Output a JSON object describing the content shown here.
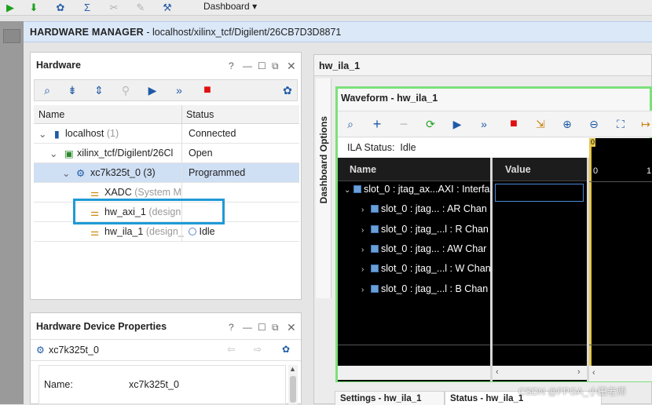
{
  "toolbar": {
    "dashboard_label": "Dashboard"
  },
  "header": {
    "title_bold": "HARDWARE MANAGER",
    "title_path": " - localhost/xilinx_tcf/Digilent/26CB7D3D8871"
  },
  "hardware": {
    "title": "Hardware",
    "columns": [
      "Name",
      "Status"
    ],
    "rows": [
      {
        "name": "localhost",
        "extra": "(1)",
        "status": "Connected"
      },
      {
        "name": "xilinx_tcf/Digilent/26Cl",
        "extra": "",
        "status": "Open"
      },
      {
        "name": "xc7k325t_0",
        "extra": "(3)",
        "status": "Programmed"
      },
      {
        "name": "XADC",
        "extra": "(System M",
        "status": ""
      },
      {
        "name": "hw_axi_1",
        "extra": "(design",
        "status": ""
      },
      {
        "name": "hw_ila_1",
        "extra": "(design_",
        "status": "Idle"
      }
    ]
  },
  "properties": {
    "title": "Hardware Device Properties",
    "device": "xc7k325t_0",
    "name_label": "Name:",
    "name_value": "xc7k325t_0"
  },
  "right": {
    "tab_title": "hw_ila_1",
    "dashboard_options": "Dashboard Options",
    "waveform_title": "Waveform - hw_ila_1",
    "ila_status": "ILA Status:  Idle",
    "col_name": "Name",
    "col_value": "Value",
    "trigger_marker": "0",
    "tick0": "0",
    "tick1": "1",
    "signals": [
      "slot_0 : jtag_ax...AXI : Interfa",
      "slot_0 : jtag... : AR Chan",
      "slot_0 : jtag_...l : R Chan",
      "slot_0 : jtag... : AW Char",
      "slot_0 : jtag_...l : W Chan",
      "slot_0 : jtag_...l : B Chan"
    ],
    "bottom_tab1": "Settings - hw_ila_1",
    "bottom_tab2": "Status - hw_ila_1"
  },
  "watermark": "CSDN @FPGA_小田老师",
  "colors": {
    "highlight_box": "#1e9ad6",
    "waveform_border": "#7be07b",
    "selection": "#cfdff4",
    "stop_red": "#e01010"
  }
}
